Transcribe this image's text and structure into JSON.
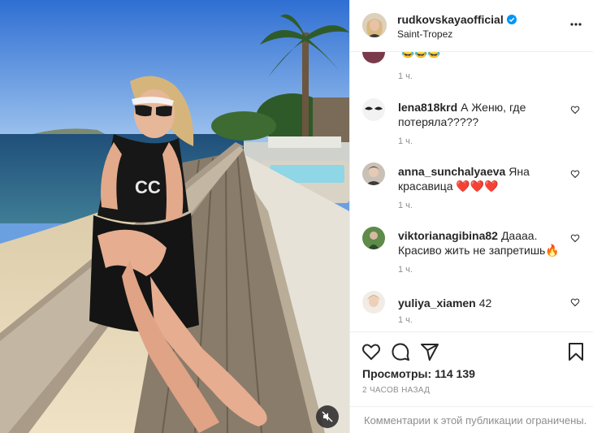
{
  "post": {
    "username": "rudkovskayaofficial",
    "verified": true,
    "location": "Saint-Tropez",
    "views_label": "Просмотры:",
    "views_count": "114 139",
    "time_ago": "2 часов назад",
    "comments_restricted": "Комментарии к этой публикации ограничены."
  },
  "comments": [
    {
      "username": "",
      "text": "😂😂😂",
      "time": "1 ч."
    },
    {
      "username": "lena818krd",
      "text": "А Женю, где потеряла?????",
      "time": "1 ч."
    },
    {
      "username": "anna_sunchalyaeva",
      "text": "Яна красавица ❤️❤️❤️",
      "time": "1 ч."
    },
    {
      "username": "viktorianagibina82",
      "text": "Даааа. Красиво жить не запретишь🔥",
      "time": "1 ч."
    },
    {
      "username": "yuliya_xiamen",
      "text": "42",
      "time": "1 ч."
    }
  ],
  "icons": {
    "verified": "verified-badge-icon",
    "more": "more-options-icon",
    "like": "heart-icon",
    "comment": "comment-bubble-icon",
    "share": "paper-plane-icon",
    "save": "bookmark-icon",
    "mute": "muted-speaker-icon"
  },
  "colors": {
    "verified": "#0095f6",
    "secondary_text": "#8e8e8e",
    "divider": "#efefef"
  }
}
